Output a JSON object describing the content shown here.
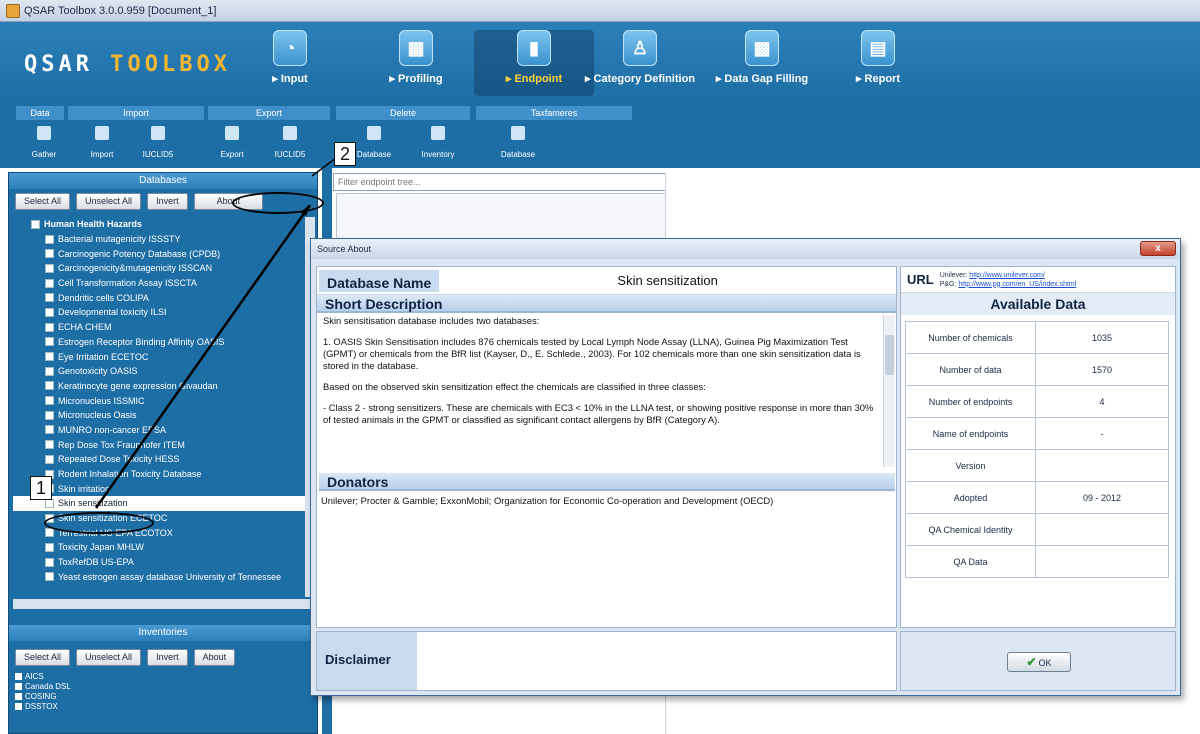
{
  "window": {
    "title": "QSAR Toolbox 3.0.0.959 [Document_1]"
  },
  "logo": {
    "part1": "QSAR ",
    "part2": "TOOLBOX"
  },
  "modules": [
    {
      "label": "▸ Input",
      "icon": "◔"
    },
    {
      "label": "▸ Profiling",
      "icon": "▦"
    },
    {
      "label": "▸ Endpoint",
      "icon": "▮"
    },
    {
      "label": "▸ Category Definition",
      "icon": "♙"
    },
    {
      "label": "▸ Data Gap Filling",
      "icon": "▩"
    },
    {
      "label": "▸ Report",
      "icon": "▤"
    }
  ],
  "ribbon_groups": [
    "Data",
    "Import",
    "Export",
    "Delete",
    "Taxfameres"
  ],
  "tools": [
    "Gather",
    "Import",
    "IUCLID5",
    "Export",
    "IUCLID5",
    "Database",
    "Inventory",
    "Database"
  ],
  "databases_panel": {
    "title": "Databases",
    "buttons": [
      "Select All",
      "Unselect All",
      "Invert",
      "About"
    ],
    "root": "Human Health Hazards",
    "items": [
      "Bacterial mutagenicity ISSSTY",
      "Carcinogenic Potency Database (CPDB)",
      "Carcinogenicity&mutagenicity ISSCAN",
      "Cell Transformation Assay ISSCTA",
      "Dendritic cells COLIPA",
      "Developmental toxicity ILSI",
      "ECHA CHEM",
      "Estrogen Receptor Binding Affinity OASIS",
      "Eye Irritation ECETOC",
      "Genotoxicity OASIS",
      "Keratinocyte gene expression Givaudan",
      "Micronucleus ISSMIC",
      "Micronucleus Oasis",
      "MUNRO non-cancer EPSA",
      "Rep Dose Tox Fraunhofer ITEM",
      "Repeated Dose Toxicity HESS",
      "Rodent Inhalation Toxicity Database",
      "Skin irritation",
      "Skin sensitization",
      "Skin sensitization ECETOC",
      "Terrestrial US-EPA ECOTOX",
      "Toxicity Japan MHLW",
      "ToxRefDB US-EPA",
      "Yeast estrogen assay database University of Tennessee"
    ],
    "selected_index": 18,
    "hscroll_label": "III"
  },
  "inventories_panel": {
    "title": "Inventories",
    "buttons": [
      "Select All",
      "Unselect All",
      "Invert",
      "About"
    ],
    "items": [
      "AICS",
      "Canada DSL",
      "COSING",
      "DSSTOX"
    ]
  },
  "endpoint_filter": {
    "placeholder": "Filter endpoint tree..."
  },
  "dialog": {
    "title": "Source About",
    "close": "x",
    "db_name_label": "Database Name",
    "db_name": "Skin sensitization",
    "short_desc_label": "Short   Description",
    "desc": [
      "Skin sensitisation database includes two databases:",
      "1.        OASIS Skin Sensitisation includes 876 chemicals tested by Local Lymph Node Assay (LLNA), Guinea Pig Maximization Test (GPMT) or chemicals from the BfR list (Kayser, D., E. Schlede., 2003). For 102 chemicals more than one skin sensitization data is stored in the database.",
      "Based on the observed skin sensitization effect the chemicals are classified in three classes:",
      "-           Class 2 - strong sensitizers.  These are chemicals with EC3 < 10% in the LLNA test, or showing positive response in more than 30% of tested animals in the GPMT or classified as significant contact allergens by BfR (Category A)."
    ],
    "donators_label": "Donators",
    "donators": "Unilever; Procter & Gamble; ExxonMobil; Organization for Economic Co-operation and Development (OECD)",
    "disclaimer_label": "Disclaimer",
    "url_label": "URL",
    "urls": [
      {
        "name": "Unilever: ",
        "link": "http://www.unilever.com/"
      },
      {
        "name": "P&G: ",
        "link": "http://www.pg.com/en_US/index.shtml"
      }
    ],
    "available_label": "Available Data",
    "available": [
      {
        "key": "Number of chemicals",
        "value": "1035"
      },
      {
        "key": "Number of data",
        "value": "1570"
      },
      {
        "key": "Number of endpoints",
        "value": "4"
      },
      {
        "key": "Name of endpoints",
        "value": "-"
      },
      {
        "key": "Version",
        "value": ""
      },
      {
        "key": "Adopted",
        "value": "09 - 2012"
      },
      {
        "key": "QA Chemical Identity",
        "value": ""
      },
      {
        "key": "QA Data",
        "value": ""
      }
    ],
    "ok_label": "OK"
  },
  "annotations": {
    "one": "1",
    "two": "2"
  }
}
